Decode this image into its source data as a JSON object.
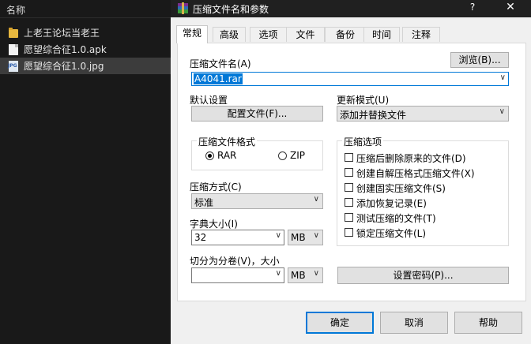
{
  "explorer": {
    "column_header": "名称",
    "files": [
      {
        "name": "上老王论坛当老王",
        "icon": "folder-icon"
      },
      {
        "name": "愿望综合征1.0.apk",
        "icon": "document-icon"
      },
      {
        "name": "愿望综合征1.0.jpg",
        "icon": "jpg-image-icon",
        "badge": "JPG"
      }
    ]
  },
  "dialog": {
    "title": "压缩文件名和参数",
    "help_label": "?",
    "close_label": "✕",
    "tabs": [
      "常规",
      "高级",
      "选项",
      "文件",
      "备份",
      "时间",
      "注释"
    ],
    "active_tab": "常规",
    "archive_name_label": "压缩文件名(A)",
    "archive_name_value": "A4041.rar",
    "browse_label": "浏览(B)...",
    "default_settings_label": "默认设置",
    "profiles_label": "配置文件(F)...",
    "update_mode_label": "更新模式(U)",
    "update_mode_value": "添加并替换文件",
    "archive_format": {
      "title": "压缩文件格式",
      "options": [
        "RAR",
        "ZIP"
      ],
      "selected": "RAR"
    },
    "archive_options": {
      "title": "压缩选项",
      "items": [
        {
          "label": "压缩后删除原来的文件(D)",
          "checked": false
        },
        {
          "label": "创建自解压格式压缩文件(X)",
          "checked": false
        },
        {
          "label": "创建固实压缩文件(S)",
          "checked": false
        },
        {
          "label": "添加恢复记录(E)",
          "checked": false
        },
        {
          "label": "测试压缩的文件(T)",
          "checked": false
        },
        {
          "label": "锁定压缩文件(L)",
          "checked": false
        }
      ]
    },
    "compression_method_label": "压缩方式(C)",
    "compression_method_value": "标准",
    "dictionary_size_label": "字典大小(I)",
    "dictionary_size_value": "32",
    "dictionary_unit": "MB",
    "split_label": "切分为分卷(V)，大小",
    "split_value": "",
    "split_unit": "MB",
    "set_password_label": "设置密码(P)...",
    "ok_label": "确定",
    "cancel_label": "取消",
    "help_button_label": "帮助"
  },
  "colors": {
    "accent": "#0078d7",
    "titlebar": "#202020",
    "explorer_bg": "#191919"
  }
}
